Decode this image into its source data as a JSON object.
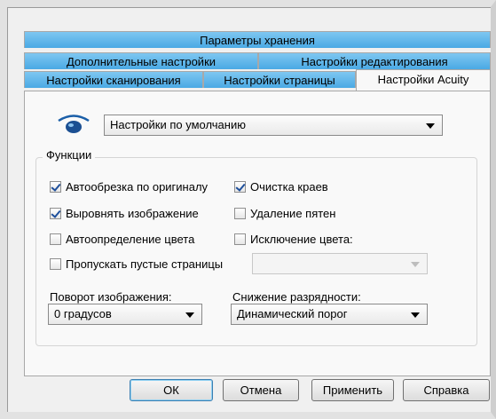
{
  "tabs": {
    "row1": [
      "Параметры хранения"
    ],
    "row2": [
      "Дополнительные настройки",
      "Настройки редактирования"
    ],
    "row3": [
      "Настройки сканирования",
      "Настройки страницы",
      "Настройки Acuity"
    ],
    "active": "Настройки Acuity"
  },
  "preset": {
    "icon": "eye-icon",
    "value": "Настройки по умолчанию"
  },
  "group": {
    "legend": "Функции"
  },
  "options": {
    "auto_crop": {
      "label": "Автообрезка по оригиналу",
      "checked": true
    },
    "edge_cleanup": {
      "label": "Очистка краев",
      "checked": true
    },
    "straighten": {
      "label": "Выровнять изображение",
      "checked": true
    },
    "despeckle": {
      "label": "Удаление пятен",
      "checked": false
    },
    "auto_color": {
      "label": "Автоопределение цвета",
      "checked": false
    },
    "color_dropout": {
      "label": "Исключение цвета:",
      "checked": false
    },
    "skip_blank": {
      "label": "Пропускать пустые страницы",
      "checked": false
    }
  },
  "rotation": {
    "label": "Поворот изображения:",
    "value": "0 градусов"
  },
  "bit_depth": {
    "label": "Снижение разрядности:",
    "value": "Динамический порог"
  },
  "buttons": {
    "ok": "ОК",
    "cancel": "Отмена",
    "apply": "Применить",
    "help": "Справка"
  }
}
